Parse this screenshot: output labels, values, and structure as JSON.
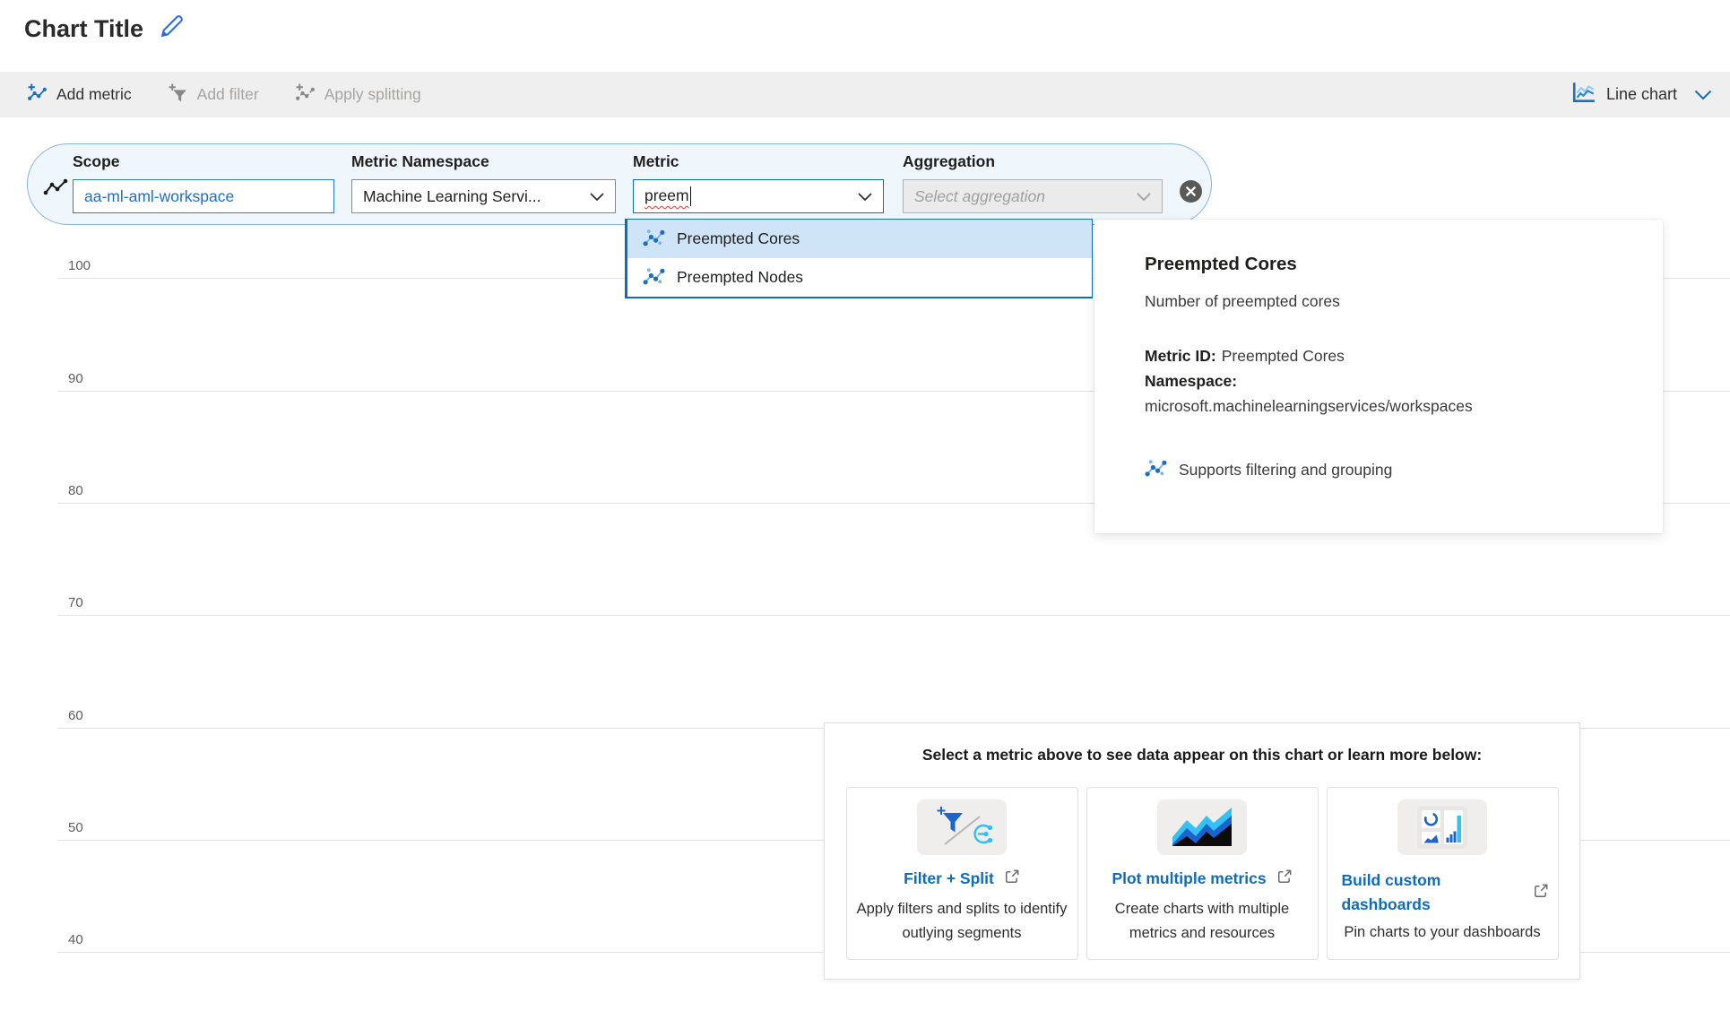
{
  "page": {
    "title": "Chart Title"
  },
  "toolbar": {
    "add_metric": "Add metric",
    "add_filter": "Add filter",
    "apply_splitting": "Apply splitting",
    "chart_type": "Line chart"
  },
  "metric_row": {
    "scope": {
      "label": "Scope",
      "value": "aa-ml-aml-workspace"
    },
    "namespace": {
      "label": "Metric Namespace",
      "value": "Machine Learning Servi..."
    },
    "metric": {
      "label": "Metric",
      "value": "preem"
    },
    "aggregation": {
      "label": "Aggregation",
      "placeholder": "Select aggregation"
    }
  },
  "metric_dropdown": {
    "options": [
      {
        "label": "Preempted Cores",
        "selected": true
      },
      {
        "label": "Preempted Nodes",
        "selected": false
      }
    ]
  },
  "tooltip": {
    "title": "Preempted Cores",
    "description": "Number of preempted cores",
    "metric_id_label": "Metric ID:",
    "metric_id_value": "Preempted Cores",
    "namespace_label": "Namespace:",
    "namespace_value": "microsoft.machinelearningservices/workspaces",
    "capability": "Supports filtering and grouping"
  },
  "chart_data": {
    "type": "line",
    "title": "Chart Title",
    "series": [],
    "y_ticks": [
      100,
      90,
      80,
      70,
      60,
      50,
      40
    ],
    "ylim": [
      40,
      100
    ],
    "grid": "horizontal",
    "note": "empty chart - no metric selected, no data plotted"
  },
  "empty_state": {
    "heading": "Select a metric above to see data appear on this chart or learn more below:",
    "cards": [
      {
        "link": "Filter + Split",
        "description": "Apply filters and splits to identify outlying segments"
      },
      {
        "link": "Plot multiple metrics",
        "description": "Create charts with multiple metrics and resources"
      },
      {
        "link": "Build custom dashboards",
        "description": "Pin charts to your dashboards"
      }
    ]
  },
  "colors": {
    "accent": "#0f6cbd",
    "link_blue": "#0f6cbd",
    "icon_blue": "#1b6ec2",
    "cyan": "#35c1f1",
    "toolbar_bg": "#efefef",
    "pill_bg": "#eff6fc",
    "pill_border": "#85b6df",
    "selected_row_bg": "#cfe4f6",
    "disabled_text": "#a19f9d",
    "gridline": "#e2e2e2",
    "text_dark": "#201f1e"
  }
}
